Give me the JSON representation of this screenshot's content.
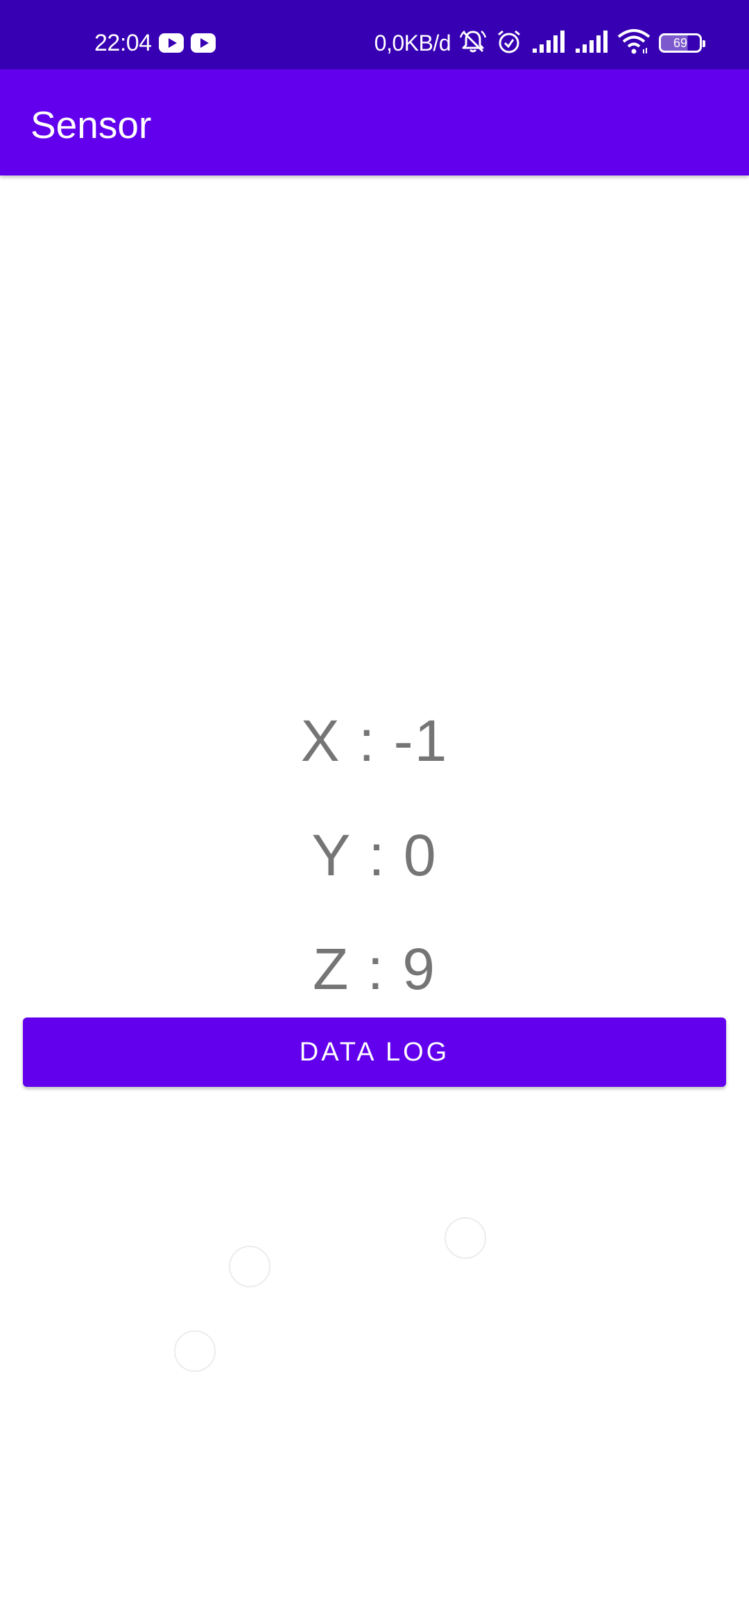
{
  "status_bar": {
    "time": "22:04",
    "notification_icons": [
      "youtube-icon",
      "youtube-icon"
    ],
    "net_speed": "0,0KB/d",
    "system_icons": [
      "bell-muted-icon",
      "alarm-icon",
      "signal-icon",
      "signal-icon",
      "wifi-icon"
    ],
    "battery_level": "69"
  },
  "app_bar": {
    "title": "Sensor"
  },
  "readings": {
    "x": "X : -1",
    "y": "Y : 0",
    "z": "Z : 9"
  },
  "actions": {
    "data_log_label": "DATA LOG"
  },
  "colors": {
    "status_bar": "#3700b3",
    "primary": "#6200ee",
    "reading_text": "#757575",
    "background": "#ffffff"
  }
}
